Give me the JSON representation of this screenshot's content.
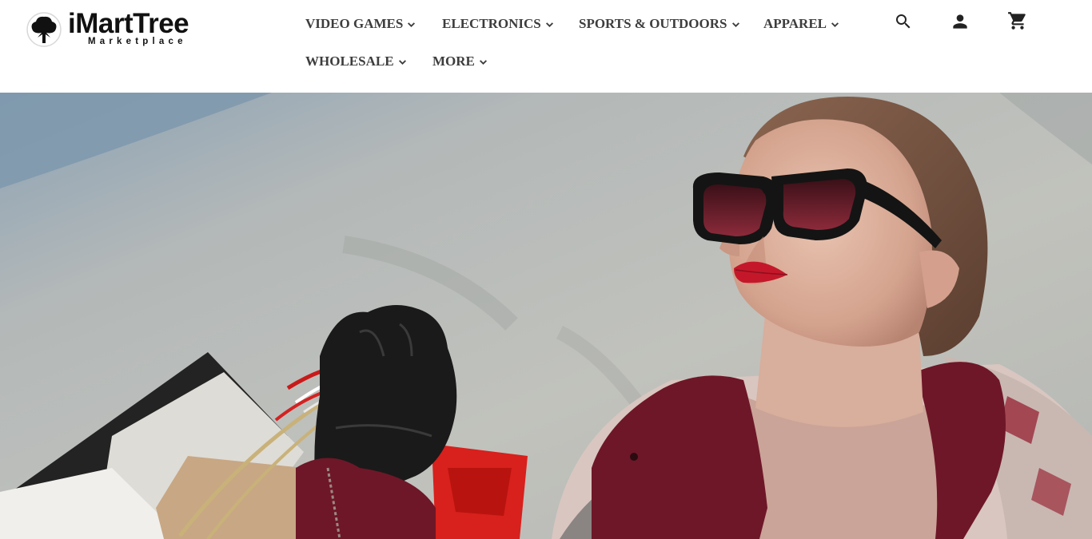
{
  "brand": {
    "name": "iMartTree",
    "tagline": "Marketplace"
  },
  "nav": {
    "items": [
      {
        "label": "VIDEO GAMES"
      },
      {
        "label": "ELECTRONICS"
      },
      {
        "label": "SPORTS & OUTDOORS"
      },
      {
        "label": "APPAREL"
      },
      {
        "label": "WHOLESALE"
      },
      {
        "label": "MORE"
      }
    ]
  },
  "header_icons": {
    "search": "search-icon",
    "account": "person-icon",
    "cart": "cart-icon"
  },
  "colors": {
    "nav_text": "#3d3d3d",
    "header_bg": "#ffffff",
    "lips": "#c4182a",
    "coat": "#6e1728"
  }
}
